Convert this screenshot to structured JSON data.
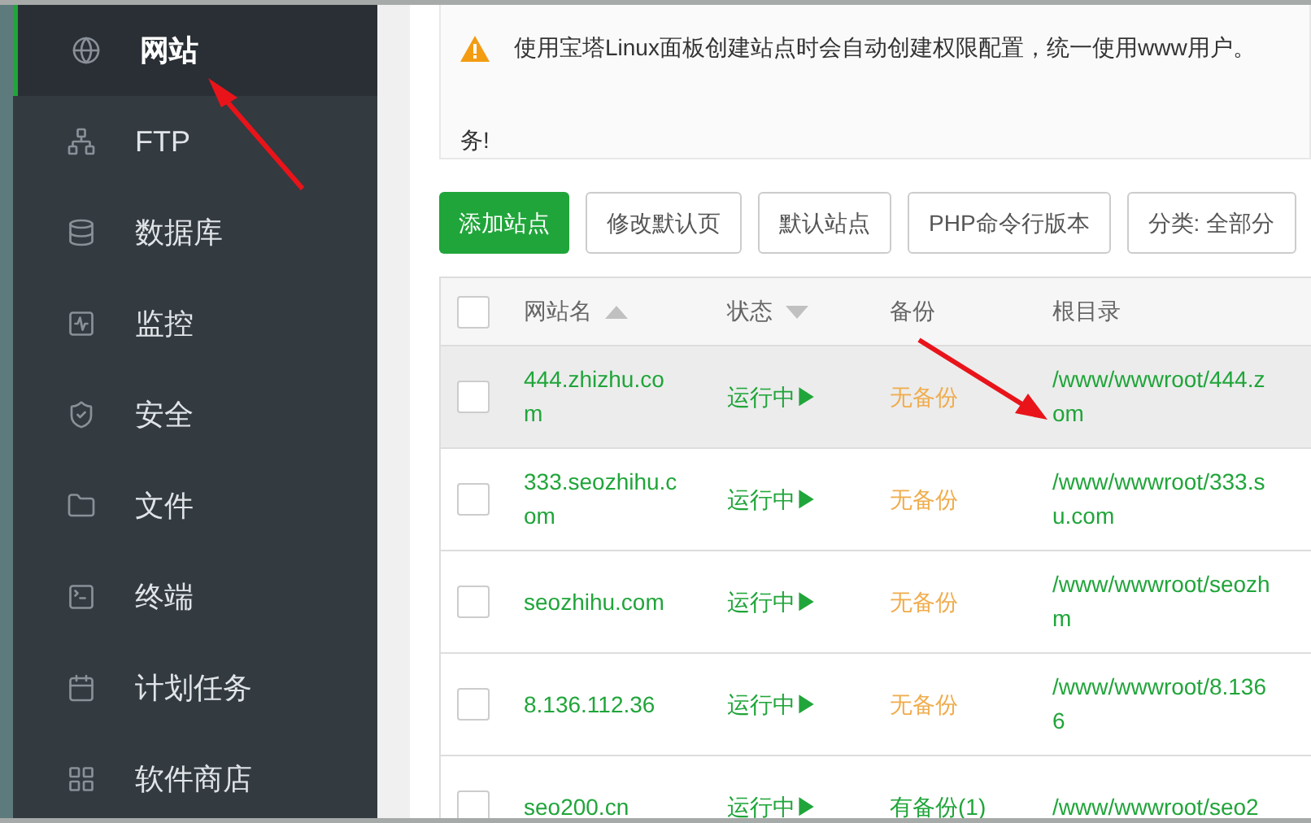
{
  "sidebar": {
    "items": [
      {
        "label": "网站",
        "kind": "globe",
        "selected": true
      },
      {
        "label": "FTP",
        "kind": "ftp",
        "selected": false
      },
      {
        "label": "数据库",
        "kind": "database",
        "selected": false
      },
      {
        "label": "监控",
        "kind": "monitor",
        "selected": false
      },
      {
        "label": "安全",
        "kind": "shield",
        "selected": false
      },
      {
        "label": "文件",
        "kind": "folder",
        "selected": false
      },
      {
        "label": "终端",
        "kind": "terminal",
        "selected": false
      },
      {
        "label": "计划任务",
        "kind": "calendar",
        "selected": false
      },
      {
        "label": "软件商店",
        "kind": "grid",
        "selected": false
      }
    ]
  },
  "notice": {
    "lines": [
      "使用宝塔Linux面板创建站点时会自动创建权限配置，统一使用www用户。",
      "务!"
    ]
  },
  "toolbar": [
    {
      "label": "添加站点",
      "primary": true
    },
    {
      "label": "修改默认页",
      "primary": false
    },
    {
      "label": "默认站点",
      "primary": false
    },
    {
      "label": "PHP命令行版本",
      "primary": false
    },
    {
      "label": "分类: 全部分",
      "primary": false
    }
  ],
  "table": {
    "all_checked": false,
    "columns": [
      {
        "label": "网站名",
        "kind": "sort_up"
      },
      {
        "label": "状态",
        "kind": "sort_down"
      },
      {
        "label": "备份",
        "kind": "plain"
      },
      {
        "label": "根目录",
        "kind": "plain"
      }
    ],
    "rows": [
      {
        "selected": true,
        "checked": false,
        "name": [
          "444.zhizhu.co",
          "m"
        ],
        "status": "运行中▶",
        "backup": "无备份",
        "backed_up": false,
        "root": [
          "/www/wwwroot/444.z",
          "om"
        ]
      },
      {
        "selected": false,
        "checked": false,
        "name": [
          "333.seozhihu.c",
          "om"
        ],
        "status": "运行中▶",
        "backup": "无备份",
        "backed_up": false,
        "root": [
          "/www/wwwroot/333.s",
          "u.com"
        ]
      },
      {
        "selected": false,
        "checked": false,
        "name": [
          "seozhihu.com"
        ],
        "status": "运行中▶",
        "backup": "无备份",
        "backed_up": false,
        "root": [
          "/www/wwwroot/seozh",
          "m"
        ]
      },
      {
        "selected": false,
        "checked": false,
        "name": [
          "8.136.112.36"
        ],
        "status": "运行中▶",
        "backup": "无备份",
        "backed_up": false,
        "root": [
          "/www/wwwroot/8.136",
          "6"
        ]
      },
      {
        "selected": false,
        "checked": false,
        "name": [
          "seo200.cn"
        ],
        "status": "运行中▶",
        "backup": "有备份(1)",
        "backed_up": true,
        "root": [
          "/www/wwwroot/seo2"
        ]
      }
    ]
  }
}
